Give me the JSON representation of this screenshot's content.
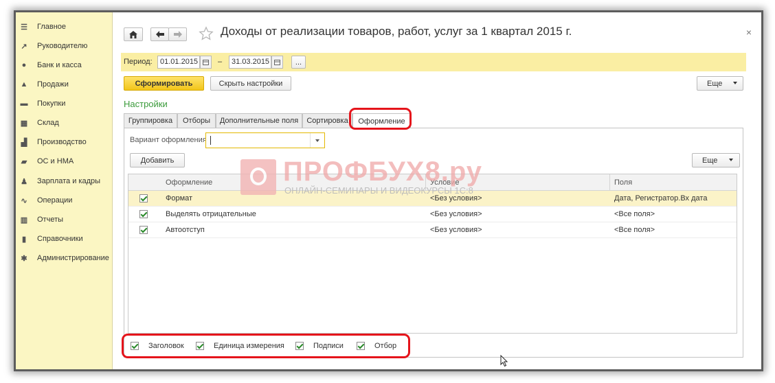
{
  "sidebar": {
    "items": [
      {
        "label": "Главное",
        "icon": "menu-icon",
        "glyph": "☰"
      },
      {
        "label": "Руководителю",
        "icon": "trend-icon",
        "glyph": "↗"
      },
      {
        "label": "Банк и касса",
        "icon": "coin-icon",
        "glyph": "●"
      },
      {
        "label": "Продажи",
        "icon": "bag-icon",
        "glyph": "▲"
      },
      {
        "label": "Покупки",
        "icon": "cart-icon",
        "glyph": "▬"
      },
      {
        "label": "Склад",
        "icon": "warehouse-icon",
        "glyph": "▦"
      },
      {
        "label": "Производство",
        "icon": "factory-icon",
        "glyph": "▟"
      },
      {
        "label": "ОС и НМА",
        "icon": "truck-icon",
        "glyph": "▰"
      },
      {
        "label": "Зарплата и кадры",
        "icon": "person-icon",
        "glyph": "♟"
      },
      {
        "label": "Операции",
        "icon": "operations-icon",
        "glyph": "∿"
      },
      {
        "label": "Отчеты",
        "icon": "bar-chart-icon",
        "glyph": "▥"
      },
      {
        "label": "Справочники",
        "icon": "book-icon",
        "glyph": "▮"
      },
      {
        "label": "Администрирование",
        "icon": "gear-icon",
        "glyph": "✱"
      }
    ]
  },
  "header": {
    "title": "Доходы от реализации товаров, работ, услуг за 1 квартал 2015 г.",
    "close": "×"
  },
  "period": {
    "label": "Период:",
    "from": "01.01.2015",
    "dash": "–",
    "to": "31.03.2015",
    "more": "..."
  },
  "actions": {
    "generate": "Сформировать",
    "hide_settings": "Скрыть настройки",
    "more": "Еще"
  },
  "settings": {
    "title": "Настройки",
    "tabs": [
      "Группировка",
      "Отборы",
      "Дополнительные поля",
      "Сортировка",
      "Оформление"
    ],
    "active_tab": "Оформление",
    "variant_label": "Вариант оформления:",
    "variant_value": "",
    "add": "Добавить",
    "more": "Еще"
  },
  "table": {
    "columns": [
      "Оформление",
      "Условие",
      "Поля"
    ],
    "rows": [
      {
        "checked": true,
        "name": "Формат",
        "condition": "<Без условия>",
        "fields": "Дата, Регистратор.Вх дата"
      },
      {
        "checked": true,
        "name": "Выделять отрицательные",
        "condition": "<Без условия>",
        "fields": "<Все поля>"
      },
      {
        "checked": true,
        "name": "Автоотступ",
        "condition": "<Без условия>",
        "fields": "<Все поля>"
      }
    ]
  },
  "options": [
    {
      "label": "Заголовок",
      "checked": true
    },
    {
      "label": "Единица измерения",
      "checked": true
    },
    {
      "label": "Подписи",
      "checked": true
    },
    {
      "label": "Отбор",
      "checked": true
    }
  ],
  "watermark": {
    "main": "ПРОФБУХ8.ру",
    "sub": "ОНЛАЙН-СЕМИНАРЫ И ВИДЕОКУРСЫ 1С:8"
  },
  "colors": {
    "sidebar_bg": "#fbf6c3",
    "period_bg": "#faeea3",
    "primary_button": "#f5cb22",
    "section_title": "#3a9a3a",
    "highlight": "#e5141b",
    "selected_row": "#fbf3c8"
  }
}
